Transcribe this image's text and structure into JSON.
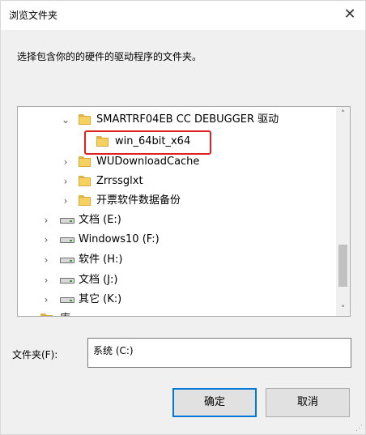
{
  "window": {
    "title": "浏览文件夹",
    "close_glyph": "✕"
  },
  "prompt": "选择包含你的的硬件的驱动程序的文件夹。",
  "tree": {
    "items": [
      {
        "label": "SMARTRF04EB CC DEBUGGER 驱动",
        "chevron": "⌄",
        "icon": "folder"
      },
      {
        "label": "win_64bit_x64",
        "chevron": "",
        "icon": "folder",
        "highlighted": true
      },
      {
        "label": "WUDownloadCache",
        "chevron": "›",
        "icon": "folder"
      },
      {
        "label": "Zrrssglxt",
        "chevron": "›",
        "icon": "folder"
      },
      {
        "label": "开票软件数据备份",
        "chevron": "›",
        "icon": "folder"
      },
      {
        "label": "文档 (E:)",
        "chevron": "›",
        "icon": "drive"
      },
      {
        "label": "Windows10 (F:)",
        "chevron": "›",
        "icon": "drive"
      },
      {
        "label": "软件 (H:)",
        "chevron": "›",
        "icon": "drive"
      },
      {
        "label": "文档 (J:)",
        "chevron": "›",
        "icon": "drive"
      },
      {
        "label": "其它 (K:)",
        "chevron": "›",
        "icon": "drive"
      },
      {
        "label": "库",
        "chevron": "›",
        "icon": "folder"
      }
    ],
    "scroll_up": "˄",
    "scroll_down": "˅"
  },
  "folder_field": {
    "label": "文件夹(F):",
    "value": "系统 (C:)"
  },
  "buttons": {
    "ok": "确定",
    "cancel": "取消"
  },
  "colors": {
    "highlight_border": "#e02020",
    "ok_border": "#0078d7"
  }
}
